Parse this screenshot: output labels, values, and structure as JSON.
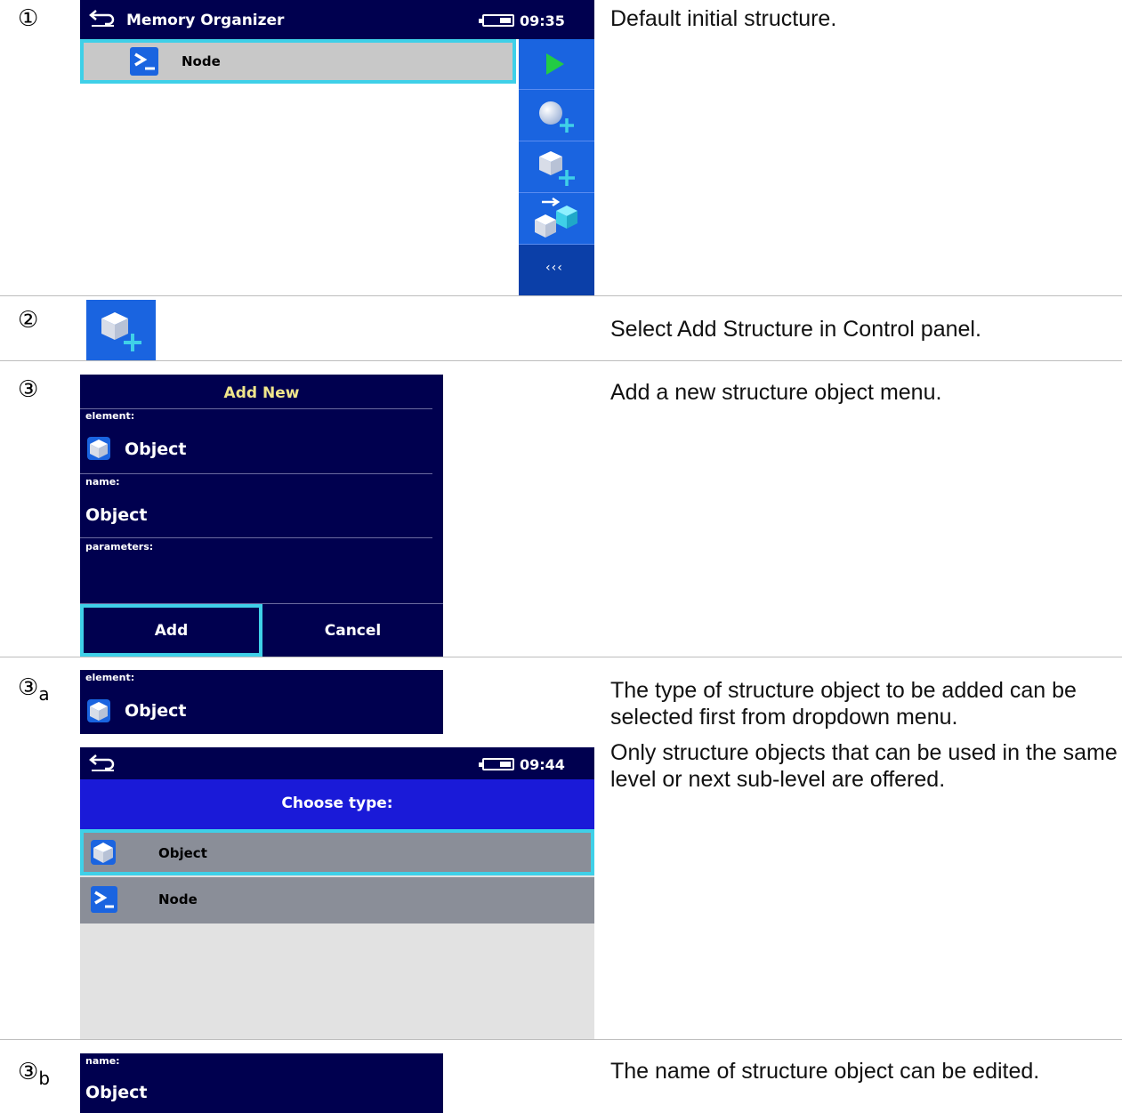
{
  "steps": {
    "s1": {
      "num": "①",
      "desc": "Default initial structure."
    },
    "s2": {
      "num": "②",
      "desc": "Select Add Structure in Control panel."
    },
    "s3": {
      "num": "③",
      "desc": "Add a new structure object menu."
    },
    "s3a": {
      "num": "③",
      "sub": "a",
      "desc1": "The type of structure object to be added can be selected first from dropdown menu.",
      "desc2": "Only structure objects that can be used in the same level or next sub-level are offered."
    },
    "s3b": {
      "num": "③",
      "sub": "b",
      "desc": "The name of structure object can be edited."
    }
  },
  "screen1": {
    "title": "Memory Organizer",
    "time": "09:35",
    "node_label": "Node",
    "more_label": "‹‹‹"
  },
  "screen3": {
    "title": "Add New",
    "element_label": "element:",
    "element_value": "Object",
    "name_label": "name:",
    "name_value": "Object",
    "parameters_label": "parameters:",
    "add_label": "Add",
    "cancel_label": "Cancel"
  },
  "screen3a": {
    "element_label": "element:",
    "element_value": "Object",
    "time": "09:44",
    "choose_title": "Choose type:",
    "options": [
      "Object",
      "Node"
    ]
  },
  "screen3b": {
    "name_label": "name:",
    "name_value": "Object"
  },
  "colors": {
    "dark_blue": "#00004f",
    "panel_blue": "#1a64e0",
    "selection_cyan": "#3fd0e8",
    "row_gray": "#c8c8c8",
    "play_green": "#22cc44"
  },
  "icons": [
    "back-arrow-icon",
    "battery-icon",
    "node-terminal-icon",
    "play-icon",
    "add-sphere-icon",
    "add-cube-icon",
    "move-cubes-icon",
    "cube-icon"
  ]
}
